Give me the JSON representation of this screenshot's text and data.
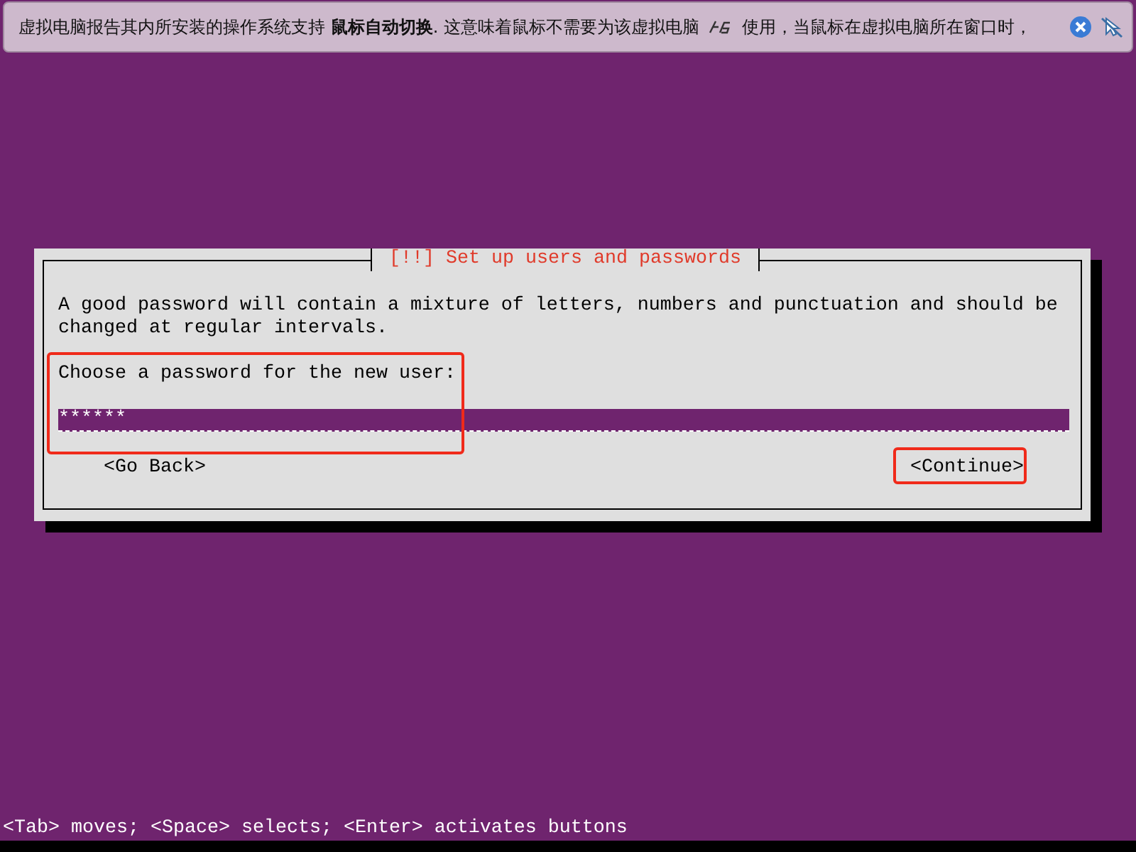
{
  "notification": {
    "message_start": "虚拟电脑报告其内所安装的操作系统支持 **鼠标自动切换**. 这意味着鼠标不需要为该虚拟电脑",
    "message_end": "使用，当鼠标在虚拟电脑所在窗口时，"
  },
  "dialog": {
    "title": "[!!] Set up users and passwords",
    "description": "A good password will contain a mixture of letters, numbers and punctuation and should be changed at regular intervals.",
    "prompt": "Choose a password for the new user:",
    "password": {
      "value": "******"
    },
    "buttons": [
      {
        "label": "<Go Back>"
      },
      {
        "label": "<Continue>"
      }
    ]
  },
  "status_bar": "<Tab> moves; <Space> selects; <Enter> activates buttons"
}
